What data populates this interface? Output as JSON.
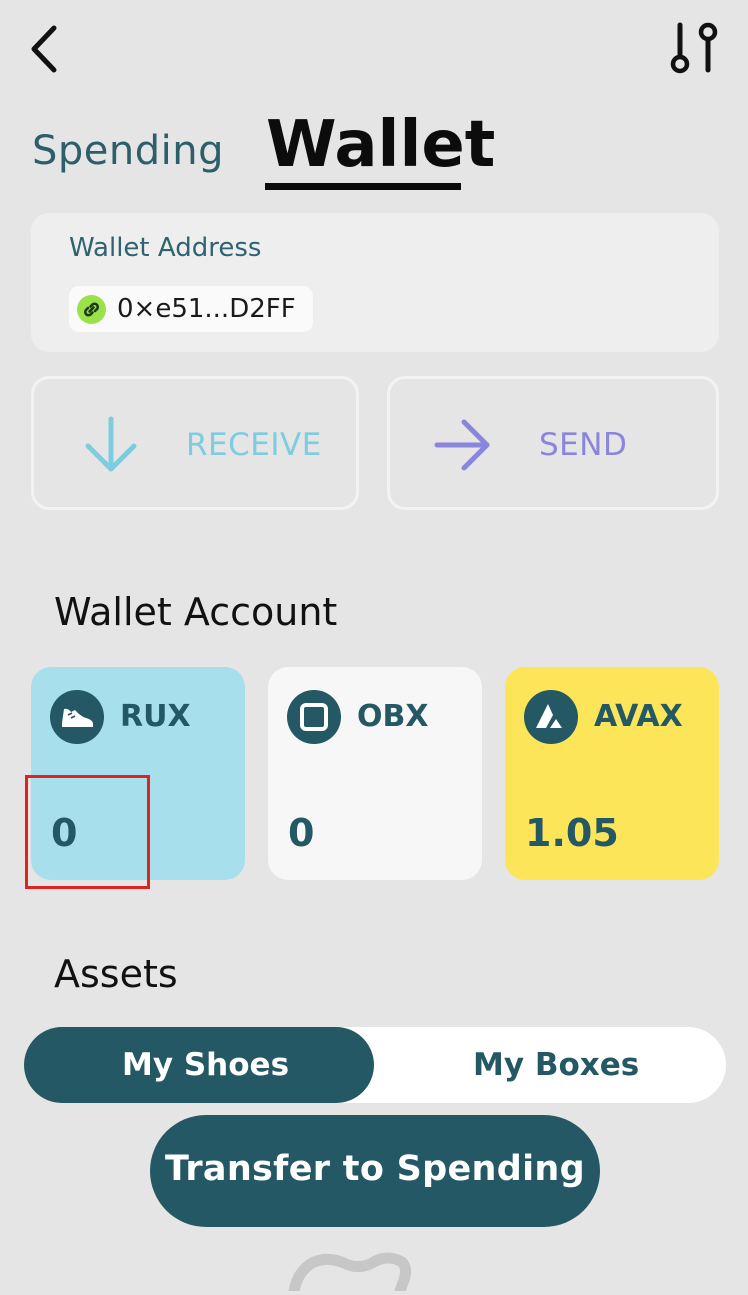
{
  "header": {
    "back_icon": "chevron-left-icon",
    "settings_icon": "sliders-icon"
  },
  "tabs": [
    {
      "label": "Spending",
      "active": false
    },
    {
      "label": "Wallet",
      "active": true
    }
  ],
  "wallet_address": {
    "label": "Wallet Address",
    "value": "0×e51...D2FF",
    "icon": "link-icon"
  },
  "actions": {
    "receive": {
      "label": "RECEIVE",
      "icon": "arrow-down-icon",
      "color": "#7ecce0"
    },
    "send": {
      "label": "SEND",
      "icon": "arrow-right-icon",
      "color": "#8a86dc"
    }
  },
  "wallet_account": {
    "title": "Wallet Account",
    "tokens": [
      {
        "name": "RUX",
        "balance": "0",
        "icon": "shoe-icon",
        "color": "#a7dfec"
      },
      {
        "name": "OBX",
        "balance": "0",
        "icon": "square-icon",
        "color": "#f7f7f7"
      },
      {
        "name": "AVAX",
        "balance": "1.05",
        "icon": "avax-icon",
        "color": "#fde55a"
      }
    ]
  },
  "assets": {
    "title": "Assets",
    "segments": [
      {
        "label": "My Shoes",
        "active": true
      },
      {
        "label": "My Boxes",
        "active": false
      }
    ]
  },
  "transfer_button": {
    "label": "Transfer to Spending"
  },
  "colors": {
    "background": "#e5e5e5",
    "primary": "#235864",
    "highlight": "#e02222"
  }
}
